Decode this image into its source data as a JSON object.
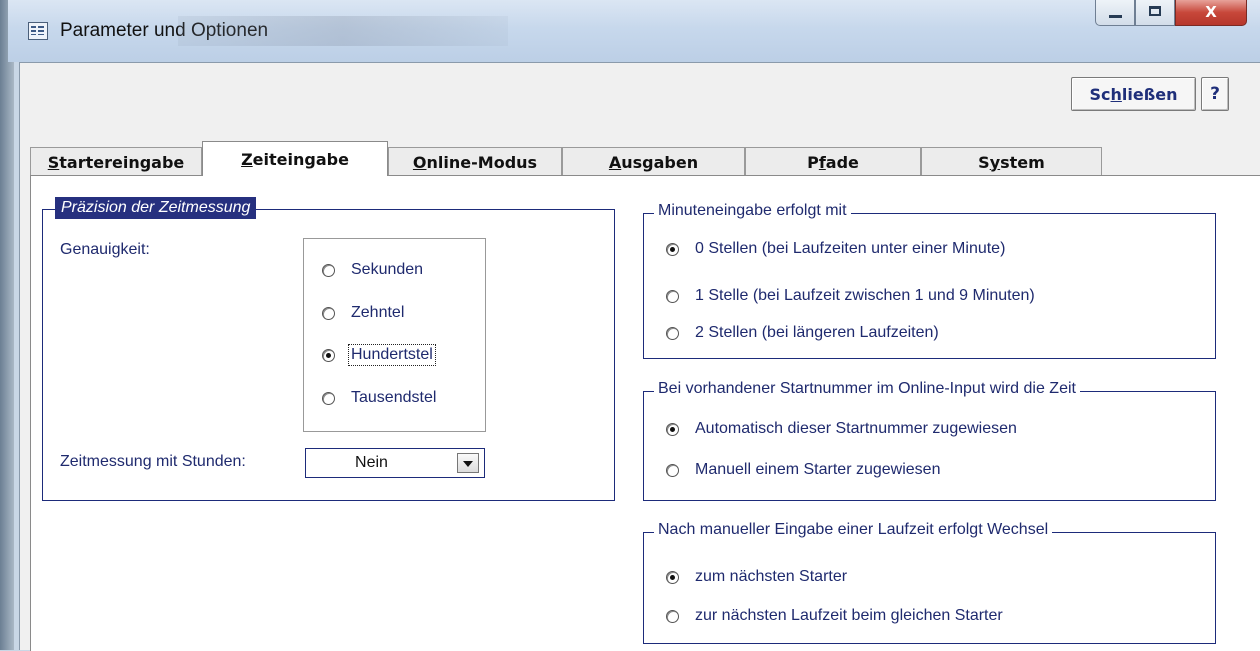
{
  "window": {
    "title": "Parameter und Optionen",
    "close_glyph": "X"
  },
  "toolbar": {
    "close_label_prefix": "Sc",
    "close_label_underlined": "h",
    "close_label_suffix": "ließen",
    "help_label": "?"
  },
  "tabs": [
    {
      "label_underlined": "S",
      "label_rest": "tartereingabe",
      "active": false
    },
    {
      "label_underlined": "Z",
      "label_rest": "eiteingabe",
      "active": true
    },
    {
      "label_underlined": "O",
      "label_rest": "nline-Modus",
      "active": false
    },
    {
      "label_underlined": "A",
      "label_rest": "usgaben",
      "active": false
    },
    {
      "label_prefix": "P",
      "label_underlined": "f",
      "label_rest": "ade",
      "active": false
    },
    {
      "label_prefix": "S",
      "label_underlined": "y",
      "label_rest": "stem",
      "active": false
    }
  ],
  "precision": {
    "legend": "Präzision der Zeitmessung",
    "accuracy_label": "Genauigkeit:",
    "options": [
      {
        "label": "Sekunden",
        "checked": false
      },
      {
        "label": "Zehntel",
        "checked": false
      },
      {
        "label": "Hundertstel",
        "checked": true
      },
      {
        "label": "Tausendstel",
        "checked": false
      }
    ],
    "hours_label": "Zeitmessung mit Stunden:",
    "hours_value": "Nein"
  },
  "minutes": {
    "legend": "Minuteneingabe erfolgt mit",
    "options": [
      {
        "label": "0 Stellen (bei Laufzeiten unter einer Minute)",
        "checked": true
      },
      {
        "label": "1 Stelle (bei Laufzeit zwischen 1 und 9 Minuten)",
        "checked": false
      },
      {
        "label": "2 Stellen (bei längeren Laufzeiten)",
        "checked": false
      }
    ]
  },
  "online": {
    "legend": "Bei vorhandener Startnummer im Online-Input wird die Zeit",
    "options": [
      {
        "label": "Automatisch dieser Startnummer zugewiesen",
        "checked": true
      },
      {
        "label": "Manuell einem Starter zugewiesen",
        "checked": false
      }
    ]
  },
  "after_manual": {
    "legend": "Nach manueller Eingabe einer Laufzeit erfolgt Wechsel",
    "options": [
      {
        "label": "zum nächsten Starter",
        "checked": true
      },
      {
        "label": "zur nächsten Laufzeit beim gleichen Starter",
        "checked": false
      }
    ]
  }
}
